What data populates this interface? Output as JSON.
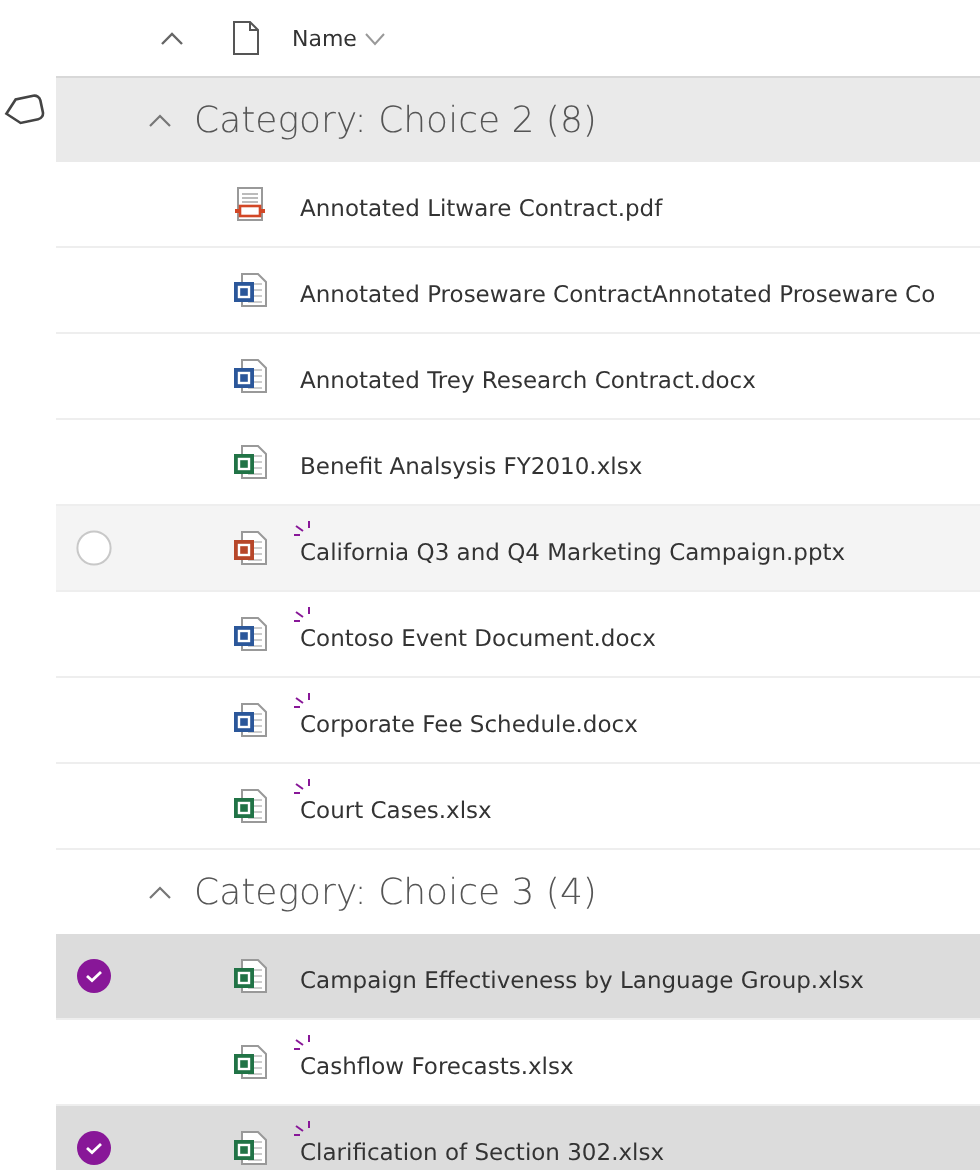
{
  "header": {
    "name_column": "Name"
  },
  "groups": [
    {
      "title": "Category: Choice 2 (8)",
      "expanded": true,
      "highlighted": true,
      "rows": [
        {
          "name": "Annotated Litware Contract.pdf",
          "kind": "pdf",
          "new": false,
          "selected": false,
          "hover": false
        },
        {
          "name": "Annotated Proseware ContractAnnotated Proseware Co",
          "kind": "word",
          "new": false,
          "selected": false,
          "hover": false
        },
        {
          "name": "Annotated Trey Research Contract.docx",
          "kind": "word",
          "new": false,
          "selected": false,
          "hover": false
        },
        {
          "name": "Benefit Analsysis FY2010.xlsx",
          "kind": "excel",
          "new": false,
          "selected": false,
          "hover": false
        },
        {
          "name": "California Q3 and Q4 Marketing Campaign.pptx",
          "kind": "powerpoint",
          "new": true,
          "selected": false,
          "hover": true
        },
        {
          "name": "Contoso Event Document.docx",
          "kind": "word",
          "new": true,
          "selected": false,
          "hover": false
        },
        {
          "name": "Corporate Fee Schedule.docx",
          "kind": "word",
          "new": true,
          "selected": false,
          "hover": false
        },
        {
          "name": "Court Cases.xlsx",
          "kind": "excel",
          "new": true,
          "selected": false,
          "hover": false
        }
      ]
    },
    {
      "title": "Category: Choice 3 (4)",
      "expanded": true,
      "highlighted": false,
      "rows": [
        {
          "name": "Campaign Effectiveness by Language Group.xlsx",
          "kind": "excel",
          "new": false,
          "selected": true,
          "hover": false
        },
        {
          "name": "Cashflow Forecasts.xlsx",
          "kind": "excel",
          "new": true,
          "selected": false,
          "hover": false
        },
        {
          "name": "Clarification of Section 302.xlsx",
          "kind": "excel",
          "new": true,
          "selected": true,
          "hover": false
        }
      ]
    }
  ]
}
